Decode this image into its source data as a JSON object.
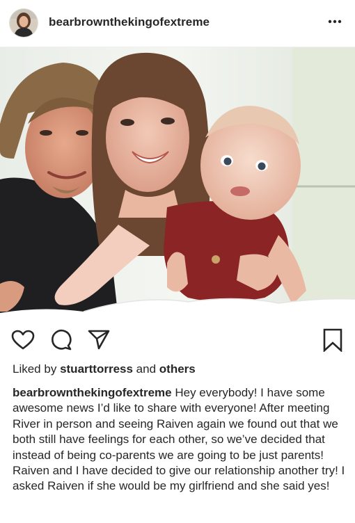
{
  "post": {
    "username": "bearbrownthekingofextreme",
    "likes_prefix": "Liked by",
    "likes_user": "stuarttorress",
    "likes_and": "and",
    "likes_others": "others",
    "caption_user": "bearbrownthekingofextreme",
    "caption_text": "Hey everybody! I have some awesome news I’d like to share with everyone! After meeting River in person and seeing Raiven again we found out that we both still have feelings for each other, so we’ve decided that instead of being co-parents we are going to be just parents! Raiven and I have decided to give our relationship another try! I asked Raiven if she would be my girlfriend and she said yes!"
  },
  "icons": {
    "more": "more-options-icon",
    "like": "heart-icon",
    "comment": "comment-icon",
    "share": "send-icon",
    "save": "bookmark-icon"
  },
  "colors": {
    "text": "#262626",
    "divider": "#efefef",
    "background": "#ffffff"
  }
}
